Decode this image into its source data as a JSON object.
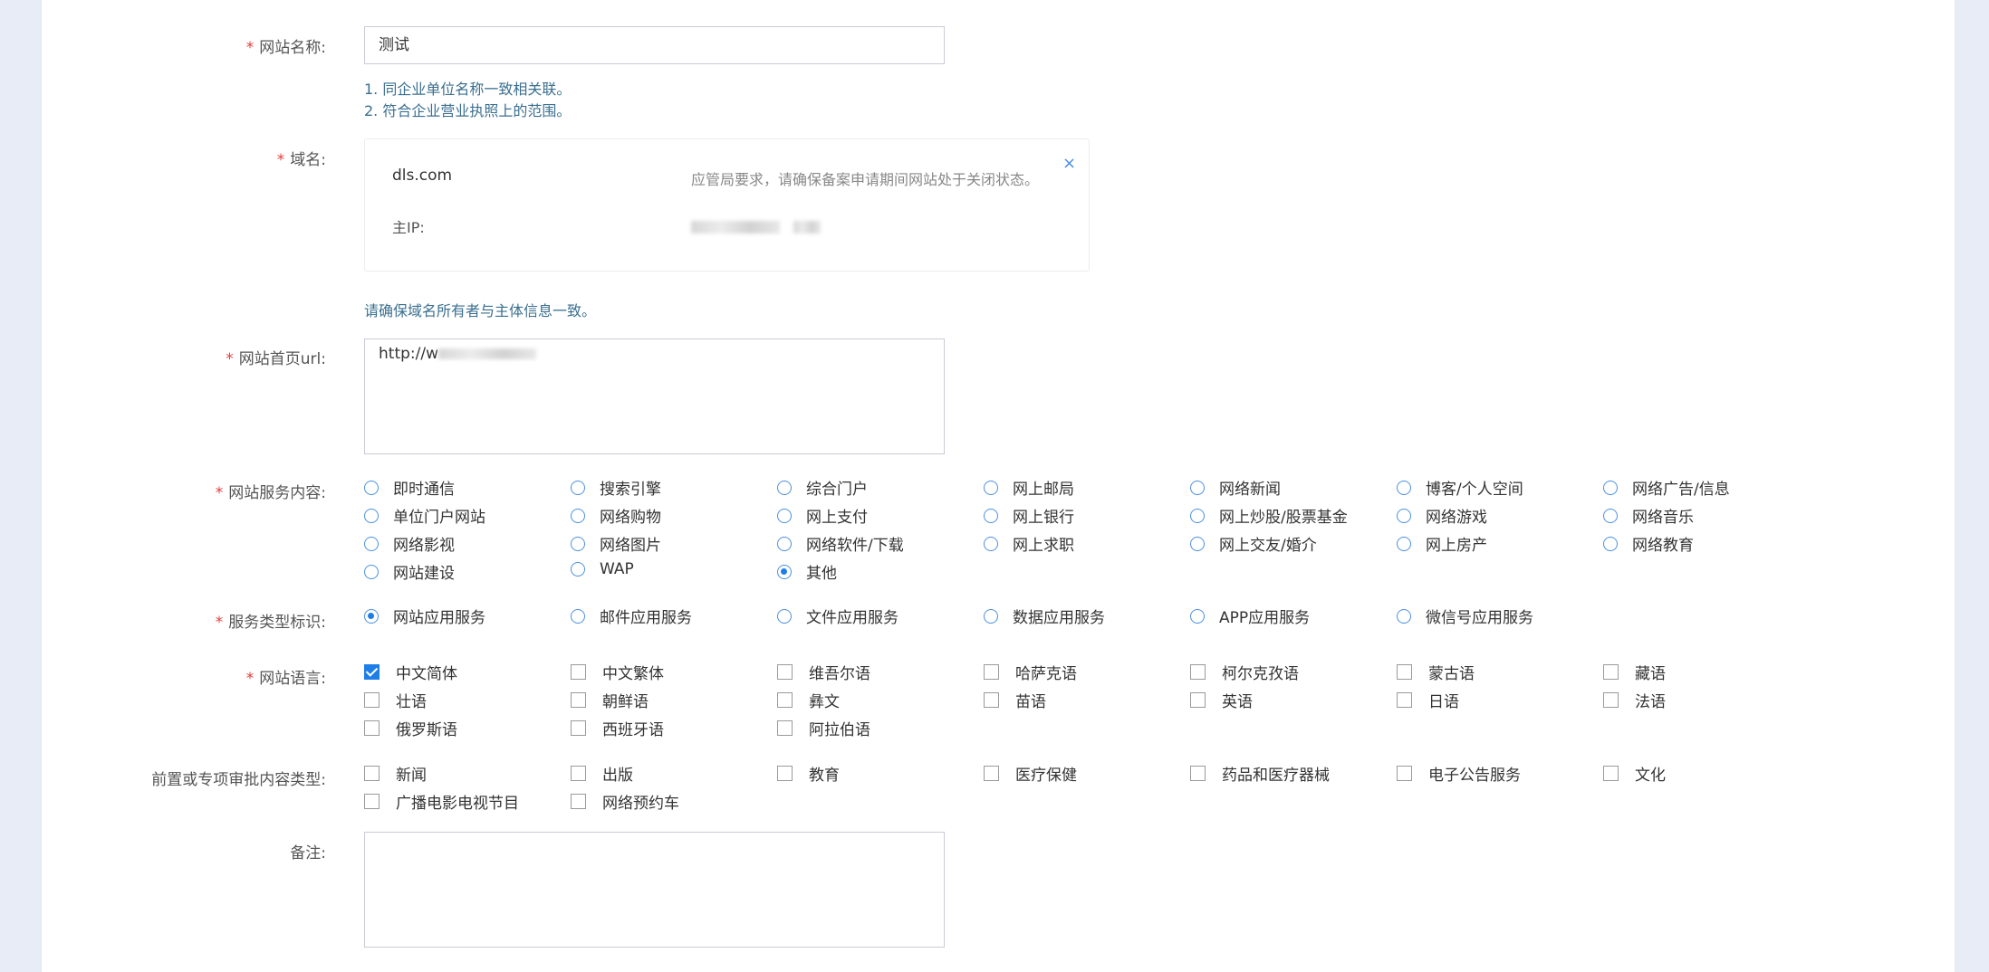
{
  "form": {
    "site_name": {
      "label": "网站名称:",
      "value": "测试",
      "hints": [
        "1. 同企业单位名称一致相关联。",
        "2. 符合企业营业执照上的范围。"
      ]
    },
    "domain": {
      "label": "域名:",
      "domain_value": "dls.com",
      "notice": "应管局要求，请确保备案申请期间网站处于关闭状态。",
      "ip_label": "主IP:",
      "close_icon": "×",
      "hint": "请确保域名所有者与主体信息一致。"
    },
    "homepage_url": {
      "label": "网站首页url:",
      "value": "http://w"
    },
    "service_content": {
      "label": "网站服务内容:",
      "options": [
        "即时通信",
        "搜索引擎",
        "综合门户",
        "网上邮局",
        "网络新闻",
        "博客/个人空间",
        "网络广告/信息",
        "单位门户网站",
        "网络购物",
        "网上支付",
        "网上银行",
        "网上炒股/股票基金",
        "网络游戏",
        "网络音乐",
        "网络影视",
        "网络图片",
        "网络软件/下载",
        "网上求职",
        "网上交友/婚介",
        "网上房产",
        "网络教育",
        "网站建设",
        "WAP",
        "其他"
      ],
      "selected": "其他"
    },
    "service_type": {
      "label": "服务类型标识:",
      "options": [
        "网站应用服务",
        "邮件应用服务",
        "文件应用服务",
        "数据应用服务",
        "APP应用服务",
        "微信号应用服务"
      ],
      "selected": "网站应用服务"
    },
    "language": {
      "label": "网站语言:",
      "options": [
        "中文简体",
        "中文繁体",
        "维吾尔语",
        "哈萨克语",
        "柯尔克孜语",
        "蒙古语",
        "藏语",
        "壮语",
        "朝鲜语",
        "彝文",
        "苗语",
        "英语",
        "日语",
        "法语",
        "俄罗斯语",
        "西班牙语",
        "阿拉伯语"
      ],
      "checked": [
        "中文简体"
      ]
    },
    "approval_type": {
      "label": "前置或专项审批内容类型:",
      "options": [
        "新闻",
        "出版",
        "教育",
        "医疗保健",
        "药品和医疗器械",
        "电子公告服务",
        "文化",
        "广播电影电视节目",
        "网络预约车"
      ],
      "checked": []
    },
    "remark": {
      "label": "备注:",
      "value": ""
    },
    "required_mark": "*"
  }
}
